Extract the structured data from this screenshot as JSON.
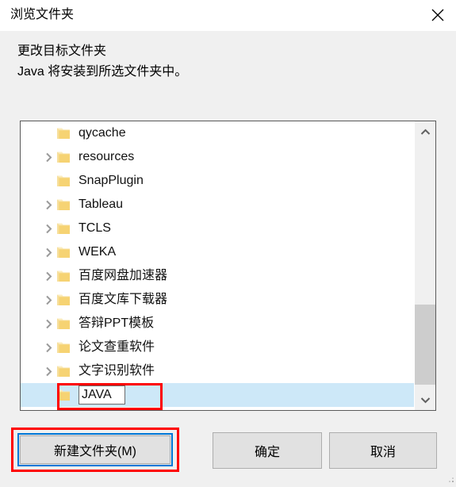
{
  "window": {
    "title": "浏览文件夹",
    "close_icon": "close-icon"
  },
  "header": {
    "line1": "更改目标文件夹",
    "line2": "Java 将安装到所选文件夹中。"
  },
  "tree": {
    "items": [
      {
        "label": "qycache",
        "expandable": false,
        "selected": false,
        "editing": false
      },
      {
        "label": "resources",
        "expandable": true,
        "selected": false,
        "editing": false
      },
      {
        "label": "SnapPlugin",
        "expandable": false,
        "selected": false,
        "editing": false
      },
      {
        "label": "Tableau",
        "expandable": true,
        "selected": false,
        "editing": false
      },
      {
        "label": "TCLS",
        "expandable": true,
        "selected": false,
        "editing": false
      },
      {
        "label": "WEKA",
        "expandable": true,
        "selected": false,
        "editing": false
      },
      {
        "label": "百度网盘加速器",
        "expandable": true,
        "selected": false,
        "editing": false
      },
      {
        "label": "百度文库下载器",
        "expandable": true,
        "selected": false,
        "editing": false
      },
      {
        "label": "答辩PPT模板",
        "expandable": true,
        "selected": false,
        "editing": false
      },
      {
        "label": "论文查重软件",
        "expandable": true,
        "selected": false,
        "editing": false
      },
      {
        "label": "文字识别软件",
        "expandable": true,
        "selected": false,
        "editing": false
      },
      {
        "label": "JAVA",
        "expandable": false,
        "selected": true,
        "editing": true
      }
    ],
    "scrollbar": {
      "up_icon": "chevron-up-icon",
      "down_icon": "chevron-down-icon"
    }
  },
  "buttons": {
    "new_folder": "新建文件夹(M)",
    "ok": "确定",
    "cancel": "取消"
  },
  "colors": {
    "accent_focus": "#0078d7",
    "annotation": "#ff0000",
    "selection": "#cde8f8",
    "folder": "#f6d373",
    "window_bg": "#f0f0f0"
  }
}
